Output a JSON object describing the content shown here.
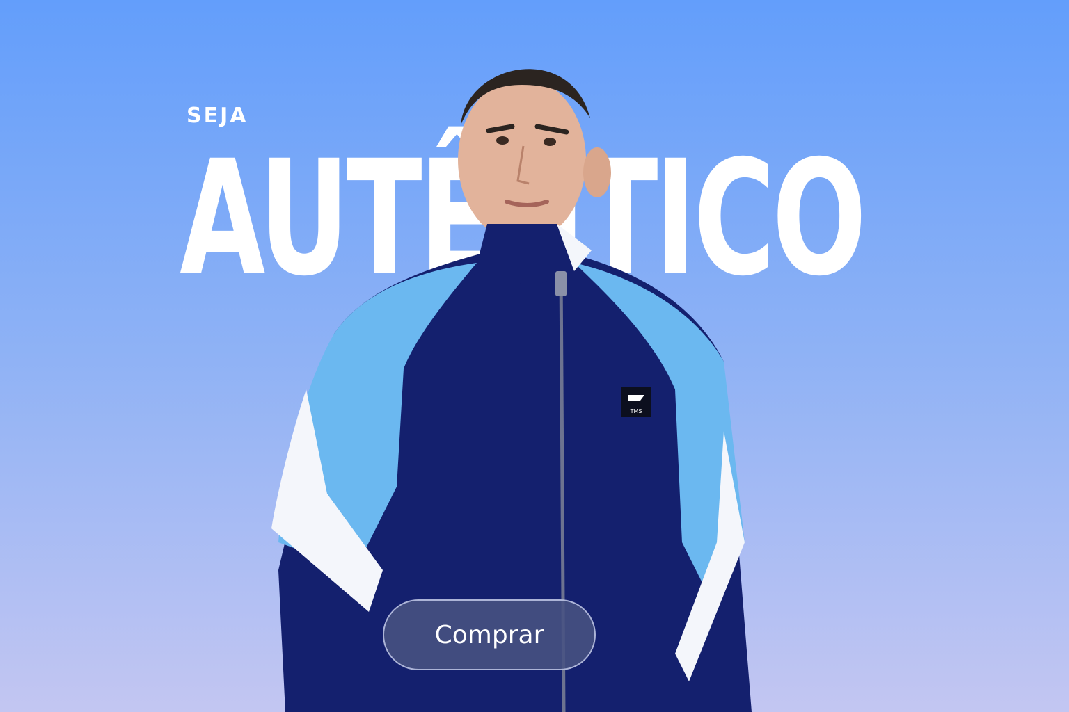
{
  "banner": {
    "eyebrow": "SEJA",
    "headline": "AUTÊNTICO",
    "cta_label": "Comprar",
    "patch_text": "TMS"
  },
  "colors": {
    "background_top": "#639efb",
    "background_bottom": "#c3c6f2",
    "jacket_navy": "#14206e",
    "jacket_light_blue": "#6bb8f0",
    "jacket_white": "#f4f6fb",
    "button_fill": "#485282"
  },
  "icons": {
    "brand_patch": "brand-logo-icon"
  }
}
